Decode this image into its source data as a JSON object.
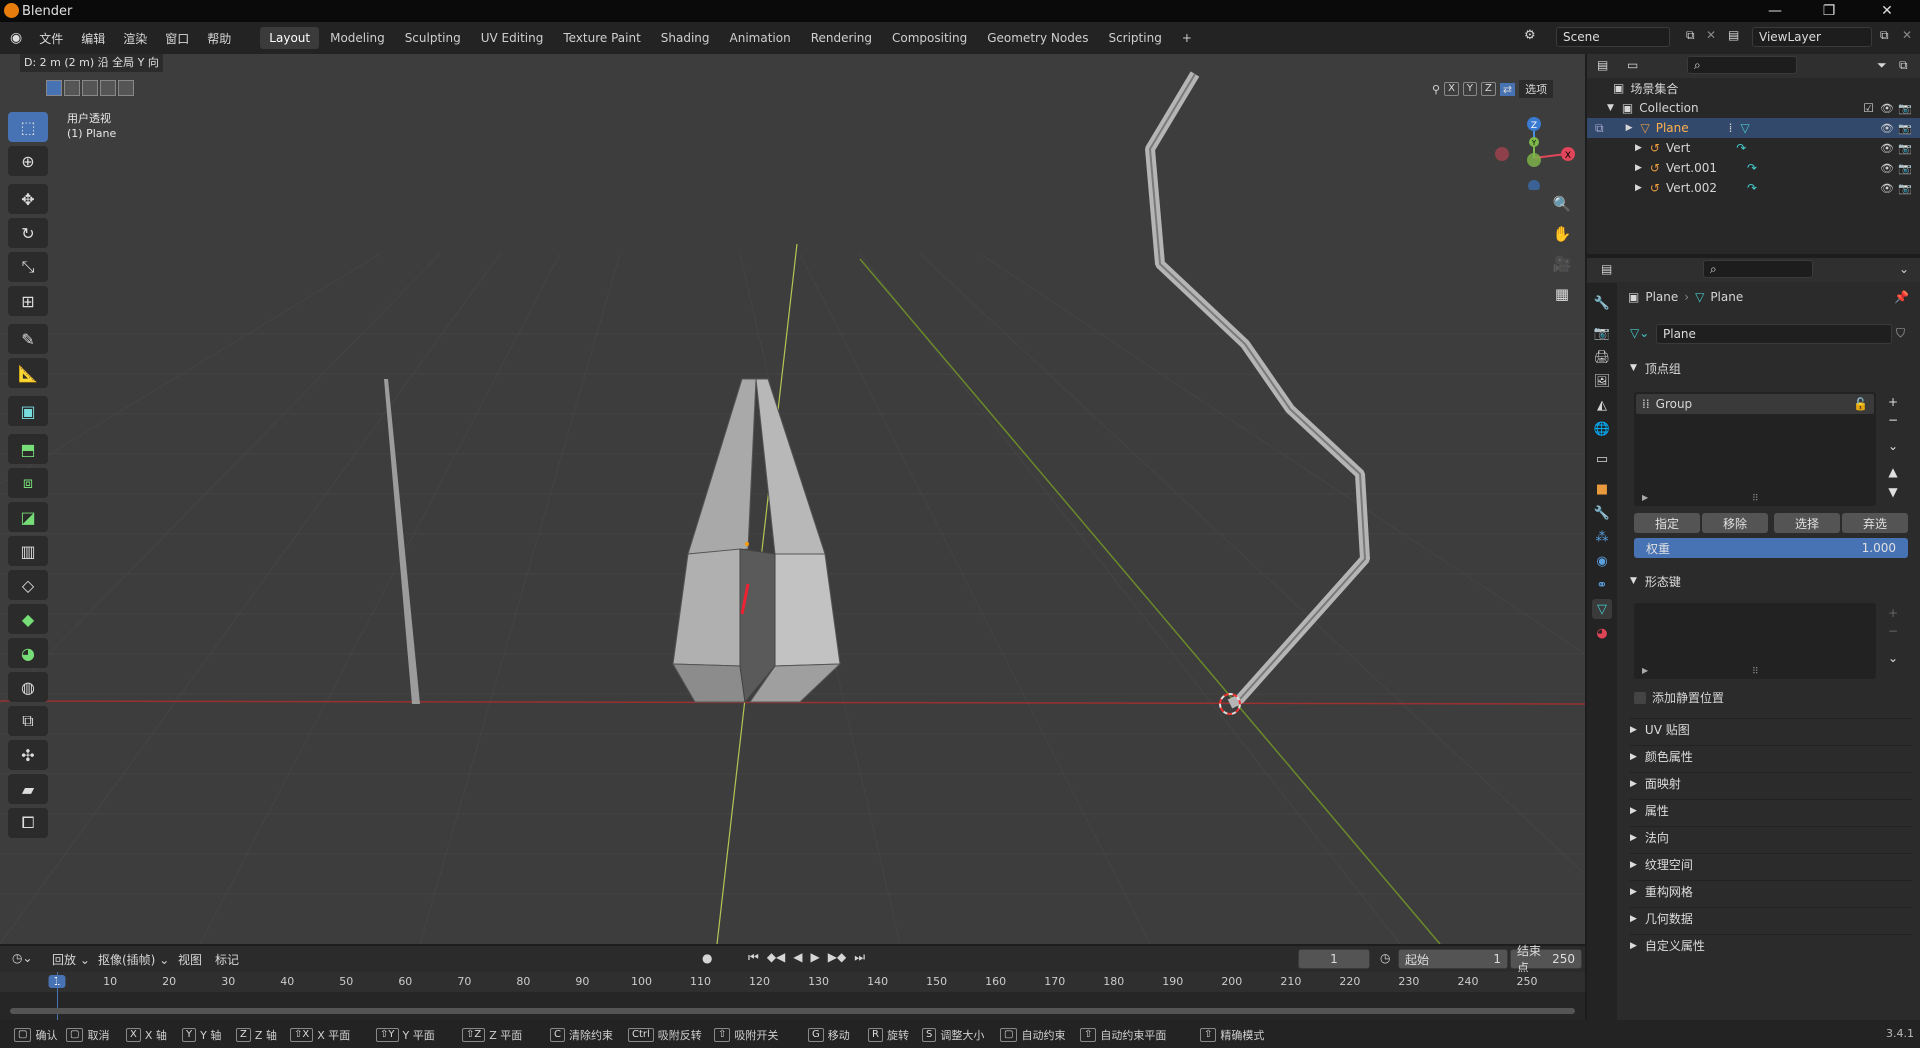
{
  "window": {
    "title": "Blender"
  },
  "menus": [
    "文件",
    "编辑",
    "渲染",
    "窗口",
    "帮助"
  ],
  "workspaces": [
    "Layout",
    "Modeling",
    "Sculpting",
    "UV Editing",
    "Texture Paint",
    "Shading",
    "Animation",
    "Rendering",
    "Compositing",
    "Geometry Nodes",
    "Scripting",
    "+"
  ],
  "scene": {
    "name": "Scene",
    "view_layer": "ViewLayer"
  },
  "viewport": {
    "status": "D: 2 m (2 m) 沿 全局 Y 向",
    "view_name": "用户透视",
    "active_object": "(1) Plane",
    "axis_labels": [
      "X",
      "Y",
      "Z"
    ],
    "options_label": "选项",
    "gizmo": {
      "x": "X",
      "y": "Y",
      "z": "Z"
    }
  },
  "outliner": {
    "root": "场景集合",
    "collection": "Collection",
    "objects": [
      "Plane",
      "Vert",
      "Vert.001",
      "Vert.002"
    ]
  },
  "properties": {
    "breadcrumb": [
      "Plane",
      "Plane"
    ],
    "mesh_name": "Plane",
    "vertex_groups": {
      "title": "顶点组",
      "items": [
        "Group"
      ],
      "assign": "指定",
      "remove": "移除",
      "select": "选择",
      "deselect": "弃选",
      "weight_label": "权重",
      "weight_value": "1.000"
    },
    "shape_keys": {
      "title": "形态键",
      "add_rest": "添加静置位置"
    },
    "panels": [
      "UV 贴图",
      "颜色属性",
      "面映射",
      "属性",
      "法向",
      "纹理空间",
      "重构网格",
      "几何数据",
      "自定义属性"
    ]
  },
  "timeline": {
    "playback": "回放",
    "keying": "抠像(插帧)",
    "view": "视图",
    "marker": "标记",
    "current_frame": "1",
    "start_label": "起始",
    "start": "1",
    "end_label": "结束点",
    "end": "250",
    "ticks": [
      "1",
      "10",
      "20",
      "30",
      "40",
      "50",
      "60",
      "70",
      "80",
      "90",
      "100",
      "110",
      "120",
      "130",
      "140",
      "150",
      "160",
      "170",
      "180",
      "190",
      "200",
      "210",
      "220",
      "230",
      "240",
      "250"
    ]
  },
  "statusbar": {
    "items": [
      {
        "key": "",
        "label": "确认"
      },
      {
        "key": "",
        "label": "取消"
      },
      {
        "key": "X",
        "label": "X 轴"
      },
      {
        "key": "Y",
        "label": "Y 轴"
      },
      {
        "key": "Z",
        "label": "Z 轴"
      },
      {
        "key": "⇧X",
        "label": "X 平面"
      },
      {
        "key": "⇧Y",
        "label": "Y 平面"
      },
      {
        "key": "⇧Z",
        "label": "Z 平面"
      },
      {
        "key": "C",
        "label": "清除约束"
      },
      {
        "key": "Ctrl",
        "label": "吸附反转"
      },
      {
        "key": "⇧",
        "label": "吸附开关"
      },
      {
        "key": "G",
        "label": "移动"
      },
      {
        "key": "R",
        "label": "旋转"
      },
      {
        "key": "S",
        "label": "调整大小"
      },
      {
        "key": "",
        "label": "自动约束"
      },
      {
        "key": "⇧",
        "label": "自动约束平面"
      },
      {
        "key": "⇧",
        "label": "精确模式"
      }
    ],
    "version": "3.4.1"
  }
}
